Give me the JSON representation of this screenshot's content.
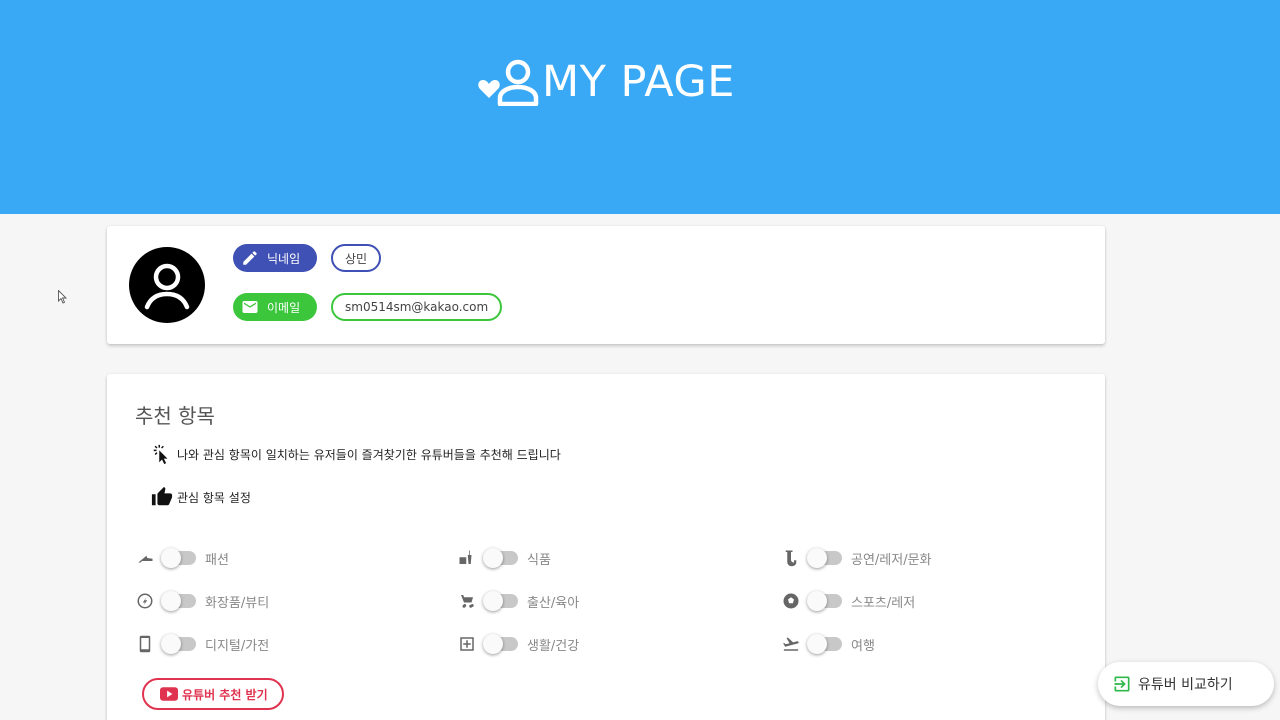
{
  "header": {
    "title": "MY PAGE",
    "icon": "heart-person-icon"
  },
  "profile": {
    "avatar_icon": "account-circle-icon",
    "nickname": {
      "label": "닉네임",
      "value": "상민",
      "icon": "pencil-icon",
      "color": "#3f51b5"
    },
    "email": {
      "label": "이메일",
      "value": "sm0514sm@kakao.com",
      "icon": "mail-icon",
      "color": "#3cc63c"
    }
  },
  "recommend": {
    "title": "추천 항목",
    "description": "나와 관심 항목이 일치하는 유저들이 즐겨찾기한 유튜버들을 추천해 드립니다",
    "interest_setting": "관심 항목 설정",
    "categories": [
      {
        "label": "패션",
        "icon": "high-heel-icon",
        "on": false
      },
      {
        "label": "식품",
        "icon": "food-drink-icon",
        "on": false
      },
      {
        "label": "공연/레저/문화",
        "icon": "saxophone-icon",
        "on": false
      },
      {
        "label": "화장품/뷰티",
        "icon": "compact-mirror-icon",
        "on": false
      },
      {
        "label": "출산/육아",
        "icon": "stroller-icon",
        "on": false
      },
      {
        "label": "스포츠/레저",
        "icon": "soccer-ball-icon",
        "on": false
      },
      {
        "label": "디지털/가전",
        "icon": "smartphone-icon",
        "on": false
      },
      {
        "label": "생활/건강",
        "icon": "medical-box-icon",
        "on": false
      },
      {
        "label": "여행",
        "icon": "airplane-takeoff-icon",
        "on": false
      }
    ],
    "youtube_button": "유튜버 추천 받기",
    "youtube_color": "#e0334f"
  },
  "compare_button": "유튜버 비교하기",
  "accent": "#3aa9f5"
}
